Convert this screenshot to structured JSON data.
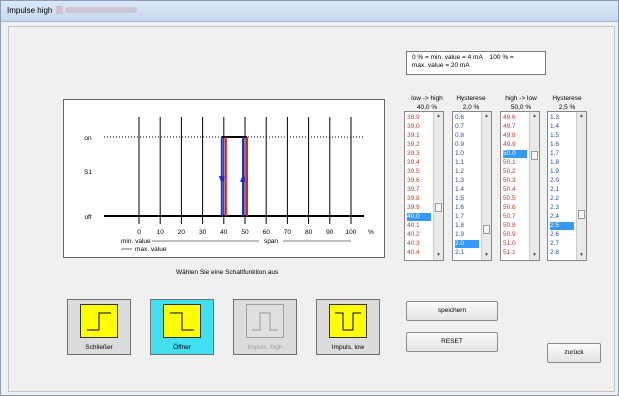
{
  "window": {
    "title": "Impulse high"
  },
  "info": {
    "text": "0 % = min. value = 4 mA    100 % =\nmax. value = 20 mA"
  },
  "chart": {
    "y_labels": {
      "on": "on",
      "s1": "S1",
      "off": "off"
    },
    "x_ticks": [
      "0",
      "10",
      "20",
      "30",
      "40",
      "50",
      "60",
      "70",
      "80",
      "90",
      "100"
    ],
    "x_unit": "%",
    "min_value_label": "min. value",
    "span_label": "span",
    "max_value_label": "max. value",
    "pulse_low": 40,
    "pulse_high": 50,
    "colors": {
      "rising": "#e02020",
      "falling": "#2030d0"
    }
  },
  "caption": "Wählen Sie eine Schaltfunktion aus",
  "lists": {
    "low_high": {
      "header": "low -> high",
      "value": "40,0 %",
      "items": [
        "38.9",
        "39.0",
        "39.1",
        "39.2",
        "39.3",
        "39.4",
        "39.5",
        "39.6",
        "39.7",
        "39.8",
        "39.9",
        "40.0",
        "40.1",
        "40.2",
        "40.3",
        "40.4"
      ],
      "selected": 11
    },
    "hyst1": {
      "header": "Hysterese",
      "value": "2,0 %",
      "items": [
        "0.6",
        "0.7",
        "0.8",
        "0.9",
        "1.0",
        "1.1",
        "1.2",
        "1.3",
        "1.4",
        "1.5",
        "1.6",
        "1.7",
        "1.8",
        "1.9",
        "2.0",
        "2.1"
      ],
      "selected": 14
    },
    "high_low": {
      "header": "high -> low",
      "value": "50,0 %",
      "items": [
        "49.6",
        "49.7",
        "49.8",
        "49.9",
        "50.0",
        "50.1",
        "50.2",
        "50.3",
        "50.4",
        "50.5",
        "50.6",
        "50.7",
        "50.8",
        "50.9",
        "51.0",
        "51.1"
      ],
      "selected": 4
    },
    "hyst2": {
      "header": "Hysterese",
      "value": "2,5 %",
      "items": [
        "1.3",
        "1.4",
        "1.5",
        "1.6",
        "1.7",
        "1.8",
        "1.9",
        "2.0",
        "2.1",
        "2.2",
        "2.3",
        "2.4",
        "2.5",
        "2.6",
        "2.7",
        "2.8"
      ],
      "selected": 12
    }
  },
  "functions": [
    {
      "label": "Schließer",
      "active": false,
      "disabled": false
    },
    {
      "label": "Öffner",
      "active": true,
      "disabled": false
    },
    {
      "label": "Impuls. high",
      "active": false,
      "disabled": true
    },
    {
      "label": "Impuls. low",
      "active": false,
      "disabled": false
    }
  ],
  "buttons": {
    "save": "speichern",
    "reset": "RESET",
    "back": "zurück"
  },
  "icon_names": {
    "schliesser": "normally-open-icon",
    "oeffner": "normally-closed-icon",
    "impuls_high": "pulse-high-icon",
    "impuls_low": "pulse-low-icon"
  }
}
